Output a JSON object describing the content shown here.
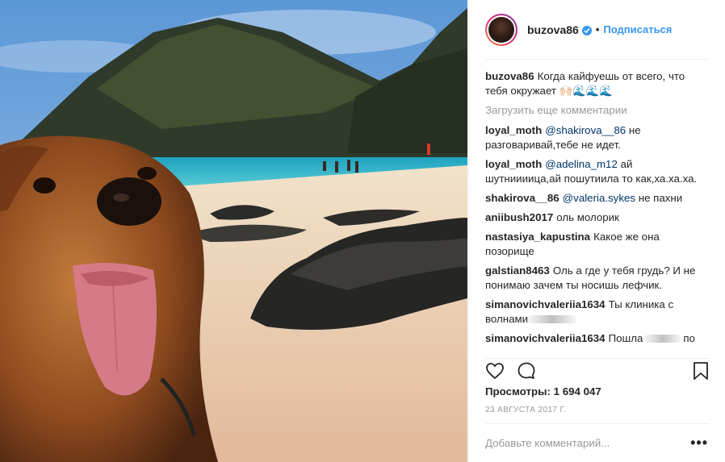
{
  "post": {
    "username": "buzova86",
    "follow_label": "Подписаться",
    "dot": "•",
    "caption": {
      "user": "buzova86",
      "text": "Когда кайфуешь от всего, что тебя окружает 🙌🏻🌊🌊🌊"
    },
    "load_more": "Загрузить еще комментарии",
    "comments": [
      {
        "user": "loyal_moth",
        "mention": "@shakirova__86",
        "text": " не разговаривай,тебе не идет."
      },
      {
        "user": "loyal_moth",
        "mention": "@adelina_m12",
        "text": " ай шутниииица,ай пошутиила то как,ха.ха.ха."
      },
      {
        "user": "shakirova__86",
        "mention": "@valeria.sykes",
        "text": " не пахни"
      },
      {
        "user": "aniibush2017",
        "text": "оль молорик"
      },
      {
        "user": "nastasiya_kapustina",
        "text": "Какое же она позорище"
      },
      {
        "user": "galstian8463",
        "text": "Оль а где у тебя грудь? И не понимаю зачем ты носишь лефчик."
      },
      {
        "user": "simanovichvaleriia1634",
        "text": "Ты клиника с волнами"
      },
      {
        "user": "simanovichvaleriia1634",
        "text": "Пошла",
        "text_after": "по"
      }
    ],
    "views_label": "Просмотры:",
    "views_count": "1 694 047",
    "date": "23 АВГУСТА 2017 Г.",
    "add_comment_placeholder": "Добавьте комментарий...",
    "options_label": "•••"
  },
  "colors": {
    "accent": "#3897f0",
    "mention": "#003569",
    "muted": "#999999",
    "text": "#262626",
    "border": "#efefef"
  },
  "icons": {
    "verified": "verified-badge-icon",
    "like": "heart-icon",
    "comment": "comment-bubble-icon",
    "save": "bookmark-icon"
  }
}
